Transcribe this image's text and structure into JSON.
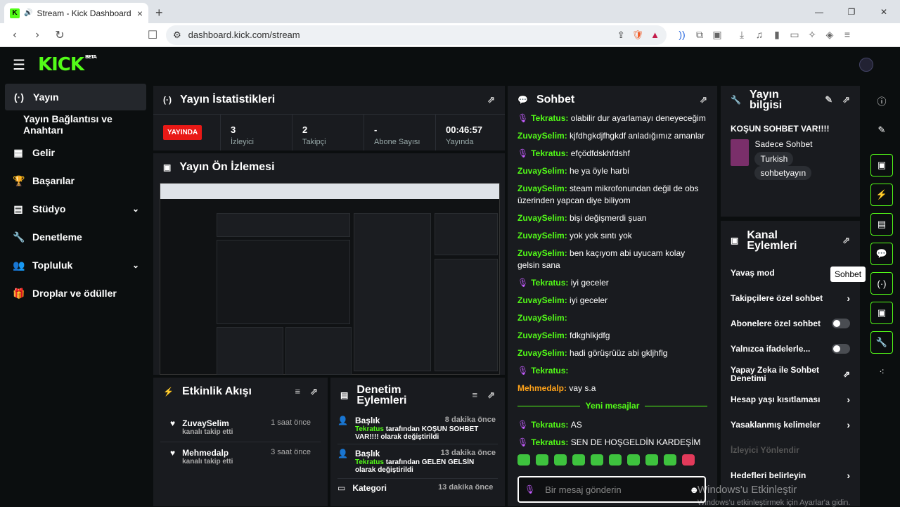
{
  "browser": {
    "tab_title": "Stream - Kick Dashboard",
    "url": "dashboard.kick.com/stream"
  },
  "header": {
    "logo": "KICK",
    "beta": "BETA"
  },
  "sidebar": {
    "items": [
      {
        "label": "Yayın",
        "icon": "broadcast-icon"
      },
      {
        "label": "Yayın Bağlantısı ve Anahtarı"
      },
      {
        "label": "Gelir",
        "icon": "dashboard-icon"
      },
      {
        "label": "Başarılar",
        "icon": "trophy-icon"
      },
      {
        "label": "Stüdyo",
        "icon": "studio-icon"
      },
      {
        "label": "Denetleme",
        "icon": "wrench-icon"
      },
      {
        "label": "Topluluk",
        "icon": "community-icon"
      },
      {
        "label": "Droplar ve ödüller",
        "icon": "gift-icon"
      }
    ]
  },
  "stats": {
    "title": "Yayın İstatistikleri",
    "live": "YAYINDA",
    "cells": [
      {
        "value": "3",
        "label": "İzleyici"
      },
      {
        "value": "2",
        "label": "Takipçi"
      },
      {
        "value": "-",
        "label": "Abone Sayısı"
      },
      {
        "value": "00:46:57",
        "label": "Yayında"
      }
    ]
  },
  "preview": {
    "title": "Yayın Ön İzlemesi"
  },
  "events": {
    "title": "Etkinlik Akışı",
    "rows": [
      {
        "user": "ZuvaySelim",
        "sub": "kanalı takip etti",
        "time": "1 saat önce"
      },
      {
        "user": "Mehmedalp",
        "sub": "kanalı takip etti",
        "time": "3 saat önce"
      }
    ]
  },
  "modlog": {
    "title": "Denetim Eylemleri",
    "rows": [
      {
        "head": "Başlık",
        "time": "8 dakika önce",
        "user": "Tekratus",
        "text": "tarafından KOŞUN SOHBET VAR!!!! olarak değiştirildi"
      },
      {
        "head": "Başlık",
        "time": "13 dakika önce",
        "user": "Tekratus",
        "text": "tarafından GELEN GELSİN olarak değiştirildi"
      },
      {
        "head": "Kategori",
        "time": "13 dakika önce",
        "user": "",
        "text": ""
      }
    ]
  },
  "chat": {
    "title": "Sohbet",
    "messages": [
      {
        "user": "Tekratus",
        "mod": true,
        "text": "olabilir dur ayarlamayı deneyeceğim"
      },
      {
        "user": "ZuvaySelim",
        "mod": false,
        "text": "kjfdhgkdjfhgkdf anladığımız amanlar"
      },
      {
        "user": "Tekratus",
        "mod": true,
        "text": "efçödfdskhfdshf"
      },
      {
        "user": "ZuvaySelim",
        "mod": false,
        "text": "he ya öyle harbi"
      },
      {
        "user": "ZuvaySelim",
        "mod": false,
        "text": "steam mikrofonundan değil de obs üzerinden yapcan diye biliyom"
      },
      {
        "user": "ZuvaySelim",
        "mod": false,
        "text": "bişi değişmerdi şuan"
      },
      {
        "user": "ZuvaySelim",
        "mod": false,
        "text": "yok yok sıntı yok"
      },
      {
        "user": "ZuvaySelim",
        "mod": false,
        "text": "ben kaçıyom abi uyucam kolay gelsin sana"
      },
      {
        "user": "Tekratus",
        "mod": true,
        "text": "iyi geceler"
      },
      {
        "user": "ZuvaySelim",
        "mod": false,
        "text": "iyi geceler"
      },
      {
        "user": "ZuvaySelim",
        "mod": false,
        "text": ""
      },
      {
        "user": "ZuvaySelim",
        "mod": false,
        "text": "fdkghlkjdfg"
      },
      {
        "user": "ZuvaySelim",
        "mod": false,
        "text": "hadi görüşrüüz abi gkljhflg"
      },
      {
        "user": "Tekratus",
        "mod": true,
        "text": ""
      },
      {
        "user": "Mehmedalp",
        "mod": false,
        "orange": true,
        "text": "vay s.a"
      }
    ],
    "new_label": "Yeni mesajlar",
    "new_messages": [
      {
        "user": "Tekratus",
        "text": "AS"
      },
      {
        "user": "Tekratus",
        "text": "SEN DE HOŞGELDİN KARDEŞİM"
      }
    ],
    "input_placeholder": "Bir mesaj gönderin"
  },
  "info": {
    "title": "Yayın bilgisi",
    "stream_title": "KOŞUN SOHBET VAR!!!!",
    "category": "Sadece Sohbet",
    "tags": [
      "Turkish",
      "sohbetyayın"
    ]
  },
  "channel_actions": {
    "title": "Kanal Eylemleri",
    "rows": [
      {
        "label": "Yavaş mod",
        "kind": "none"
      },
      {
        "label": "Takipçilere özel sohbet",
        "kind": "chevron"
      },
      {
        "label": "Abonelere özel sohbet",
        "kind": "toggle"
      },
      {
        "label": "Yalnızca ifadelerle...",
        "kind": "toggle"
      },
      {
        "label": "Yapay Zeka ile Sohbet Denetimi",
        "kind": "external"
      },
      {
        "label": "Hesap yaşı kısıtlaması",
        "kind": "chevron"
      },
      {
        "label": "Yasaklanmış kelimeler",
        "kind": "chevron"
      },
      {
        "label": "İzleyici Yönlendir",
        "kind": "disabled"
      },
      {
        "label": "Hedefleri belirleyin",
        "kind": "chevron"
      }
    ]
  },
  "rail": {
    "tooltip": "Sohbet"
  },
  "watermark": {
    "line1": "Windows'u Etkinleştir",
    "line2": "Windows'u etkinleştirmek için Ayarlar'a gidin."
  }
}
